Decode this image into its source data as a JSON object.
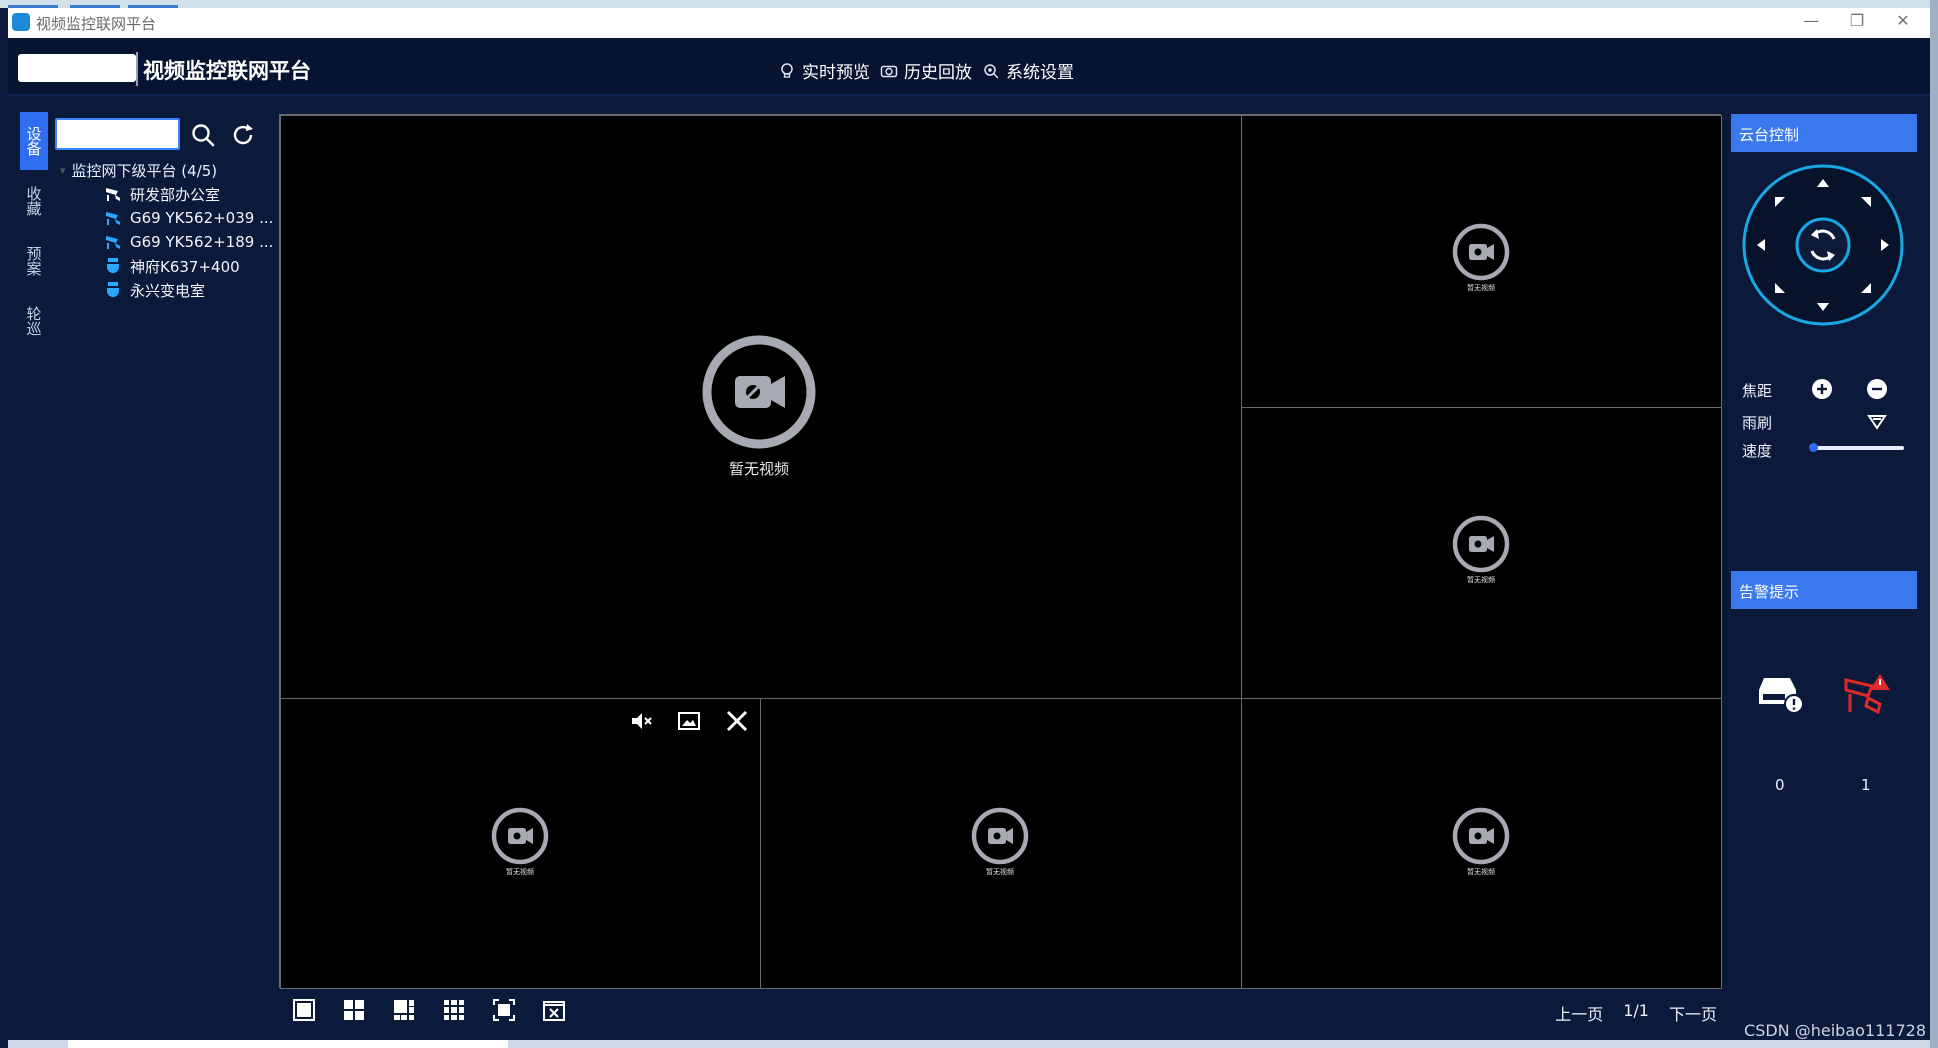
{
  "window": {
    "title": "视频监控联网平台",
    "controls": [
      "—",
      "❐",
      "✕"
    ]
  },
  "header": {
    "app_title": "视频监控联网平台",
    "nav": [
      {
        "label": "实时预览",
        "icon": "bulb-icon"
      },
      {
        "label": "历史回放",
        "icon": "camera-icon"
      },
      {
        "label": "系统设置",
        "icon": "settings-icon"
      }
    ]
  },
  "sidebar": {
    "tabs": [
      "设备",
      "收藏",
      "预案",
      "轮巡"
    ],
    "active_tab": "设备",
    "search": {
      "value": "",
      "placeholder": ""
    },
    "tree": {
      "root_label": "监控网下级平台 (4/5)",
      "nodes": [
        {
          "label": "研发部办公室",
          "icon": "gun-camera-icon",
          "color": "#ffffff"
        },
        {
          "label": "G69 YK562+039 ...",
          "icon": "gun-camera-icon",
          "color": "#29a8ff"
        },
        {
          "label": "G69 YK562+189 ...",
          "icon": "gun-camera-icon",
          "color": "#29a8ff"
        },
        {
          "label": "神府K637+400",
          "icon": "dome-camera-icon",
          "color": "#29a8ff"
        },
        {
          "label": "永兴变电室",
          "icon": "dome-camera-icon",
          "color": "#29a8ff"
        }
      ]
    }
  },
  "video": {
    "no_video_text": "暂无视频",
    "cells": [
      "cell-1",
      "cell-2",
      "cell-3",
      "cell-4",
      "cell-5",
      "cell-6"
    ],
    "selected_cell_controls": [
      "mute-icon",
      "snapshot-icon",
      "close-icon"
    ]
  },
  "toolbar": {
    "layouts": [
      "layout-1-icon",
      "layout-4-icon",
      "layout-6-icon",
      "layout-9-icon",
      "fullscreen-icon",
      "close-all-icon"
    ],
    "prev_label": "上一页",
    "page": "1/1",
    "next_label": "下一页"
  },
  "ptz": {
    "title": "云台控制",
    "focus_label": "焦距",
    "wiper_label": "雨刷",
    "speed_label": "速度",
    "speed_value": 0.0
  },
  "alarm": {
    "title": "告警提示",
    "counts": [
      "0",
      "1"
    ]
  },
  "watermark": "CSDN @heibao111728",
  "colors": {
    "background": "#0b1a3a",
    "accent": "#3a78ee",
    "camera_blue": "#29a8ff",
    "alarm_red": "#e02a2a"
  }
}
